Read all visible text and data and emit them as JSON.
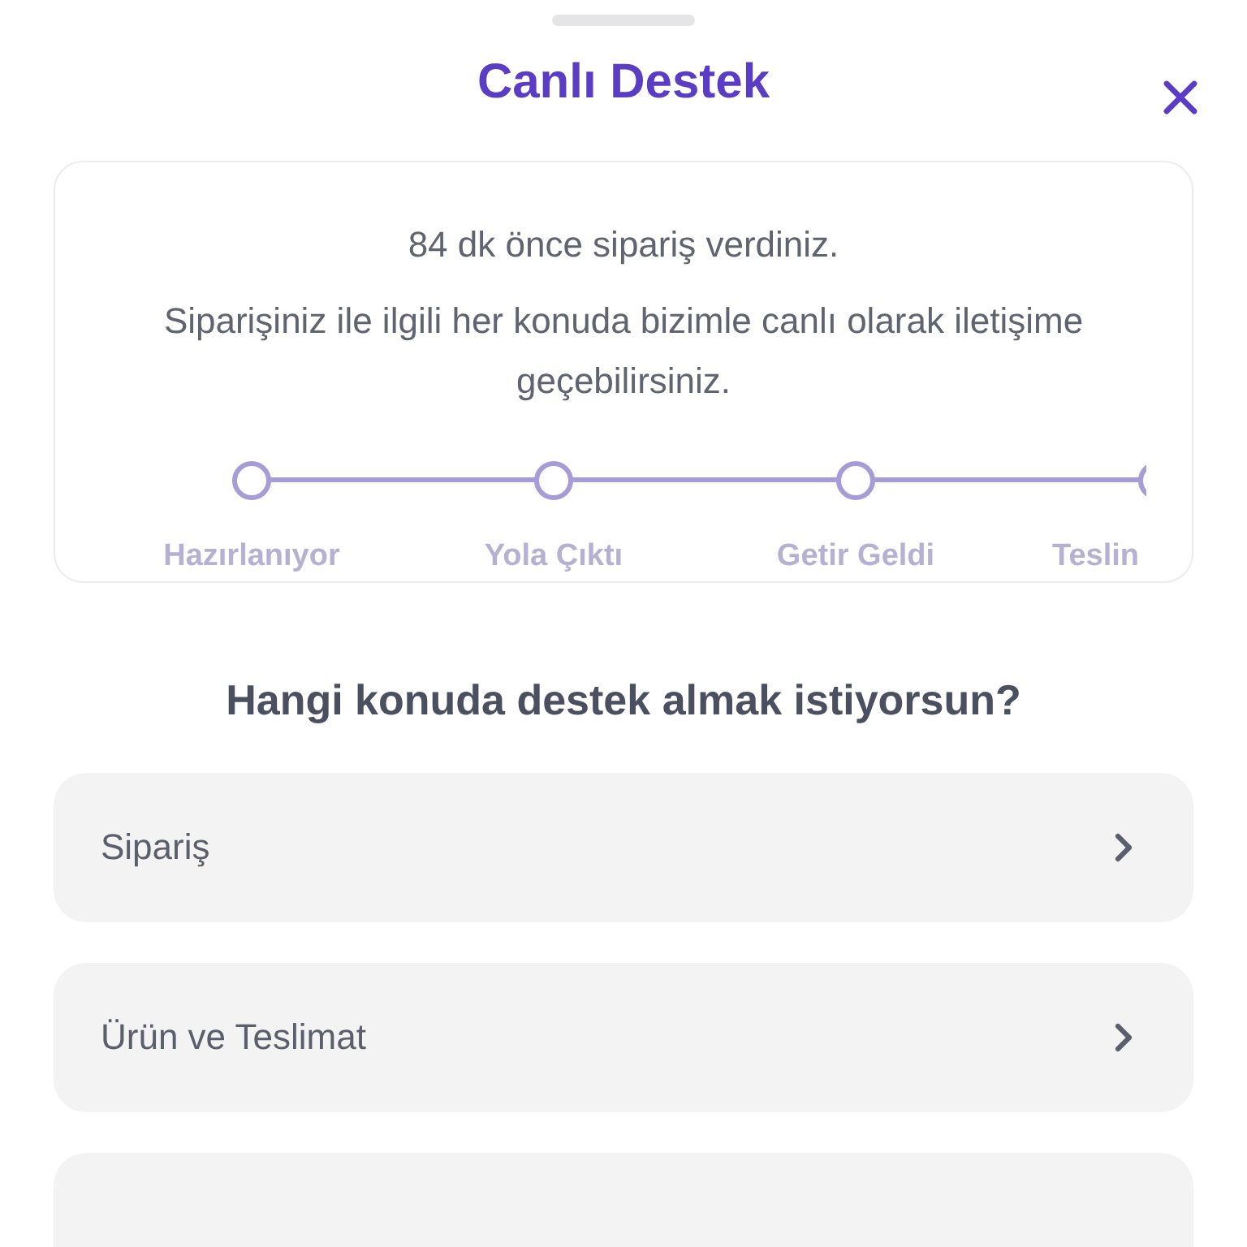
{
  "header": {
    "title": "Canlı Destek"
  },
  "order_card": {
    "time_text": "84 dk önce sipariş verdiniz.",
    "description": "Siparişiniz ile ilgili her konuda bizimle canlı olarak iletişime geçebilirsiniz.",
    "steps": [
      {
        "label": "Hazırlanıyor",
        "kind": "full"
      },
      {
        "label": "Yola Çıktı",
        "kind": "full"
      },
      {
        "label": "Getir Geldi",
        "kind": "full"
      },
      {
        "label": "Teslin",
        "kind": "cut"
      }
    ]
  },
  "question": "Hangi konuda destek almak istiyorsun?",
  "topics": [
    {
      "label": "Sipariş"
    },
    {
      "label": "Ürün ve Teslimat"
    }
  ]
}
